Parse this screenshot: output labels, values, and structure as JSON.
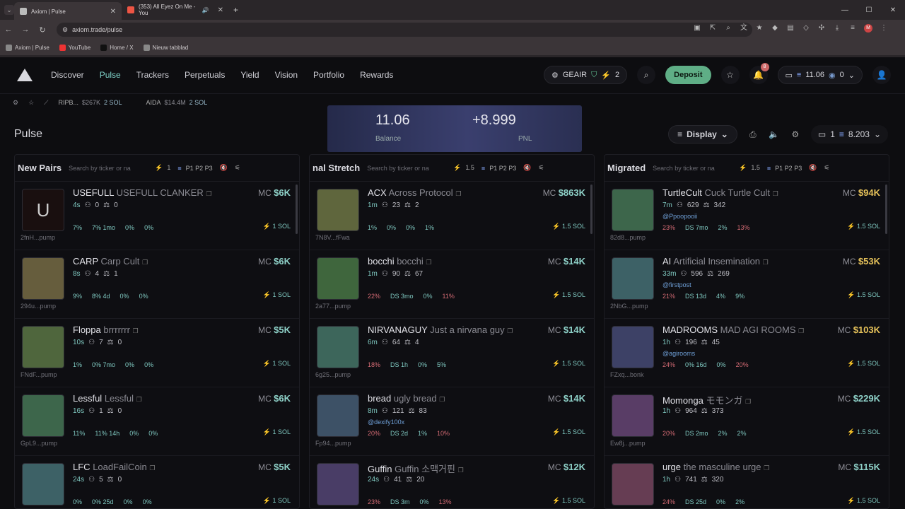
{
  "browser": {
    "tabs": [
      {
        "label": "Axiom | Pulse"
      },
      {
        "label": "(353) All Eyez On Me - You"
      }
    ],
    "url": "axiom.trade/pulse",
    "bookmarks": [
      "Axiom | Pulse",
      "YouTube",
      "Home / X",
      "Nieuw tabblad"
    ],
    "profile": "M"
  },
  "nav": {
    "items": [
      "Discover",
      "Pulse",
      "Trackers",
      "Perpetuals",
      "Yield",
      "Vision",
      "Portfolio",
      "Rewards"
    ],
    "gear_label": "GEAIR",
    "bolt_count": "2",
    "deposit": "Deposit",
    "notif": "8",
    "sol_balance": "11.06",
    "usdc": "0"
  },
  "ticker": [
    {
      "name": "RIPB...",
      "mc": "$267K",
      "sol": "2 SOL"
    },
    {
      "name": "AIDA",
      "mc": "$14.4M",
      "sol": "2 SOL"
    }
  ],
  "page": {
    "title": "Pulse",
    "display": "Display",
    "wallet_count": "1",
    "wallet_sol": "8.203"
  },
  "overlay": {
    "balance": "11.06",
    "balance_label": "Balance",
    "pnl": "+8.999",
    "pnl_label": "PNL"
  },
  "columns": [
    {
      "title": "New Pairs",
      "search": "Search by ticker or na",
      "bolt": "1",
      "presets": "P1 P2 P3",
      "rows": [
        {
          "ticker": "USEFULL",
          "name": "USEFULL CLANKER",
          "age": "4s",
          "holders": "0",
          "pro": "0",
          "mc": "$6K",
          "addr": "2fnH...pump",
          "p": [
            "7%",
            "7% 1mo",
            "0%",
            "0%"
          ],
          "sol": "1 SOL",
          "letter": "U"
        },
        {
          "ticker": "CARP",
          "name": "Carp Cult",
          "age": "8s",
          "holders": "4",
          "pro": "1",
          "mc": "$6K",
          "addr": "294u...pump",
          "p": [
            "9%",
            "8% 4d",
            "0%",
            "0%"
          ],
          "sol": "1 SOL"
        },
        {
          "ticker": "Floppa",
          "name": "brrrrrrr",
          "age": "10s",
          "holders": "7",
          "pro": "0",
          "mc": "$5K",
          "addr": "FNdF...pump",
          "p": [
            "1%",
            "0% 7mo",
            "0%",
            "0%"
          ],
          "sol": "1 SOL"
        },
        {
          "ticker": "Lessful",
          "name": "Lessful",
          "age": "16s",
          "holders": "1",
          "pro": "0",
          "mc": "$6K",
          "addr": "GpL9...pump",
          "p": [
            "11%",
            "11% 14h",
            "0%",
            "0%"
          ],
          "sol": "1 SOL"
        },
        {
          "ticker": "LFC",
          "name": "LoadFailCoin",
          "age": "24s",
          "holders": "5",
          "pro": "0",
          "mc": "$5K",
          "addr": "",
          "p": [
            "0%",
            "0% 25d",
            "0%",
            "0%"
          ],
          "sol": "1 SOL"
        }
      ]
    },
    {
      "title": "nal Stretch",
      "search": "Search by ticker or na",
      "bolt": "1.5",
      "presets": "P1 P2 P3",
      "rows": [
        {
          "ticker": "ACX",
          "name": "Across Protocol",
          "age": "1m",
          "holders": "23",
          "pro": "2",
          "mc": "$863K",
          "addr": "7N8V...fFwa",
          "p": [
            "1%",
            "0%",
            "0%",
            "1%"
          ],
          "sol": "1.5 SOL"
        },
        {
          "ticker": "bocchi",
          "name": "bocchi",
          "age": "1m",
          "holders": "90",
          "pro": "67",
          "mc": "$14K",
          "addr": "2a77...pump",
          "p": [
            "22%",
            "DS 3mo",
            "0%",
            "11%"
          ],
          "sol": "1.5 SOL"
        },
        {
          "ticker": "NIRVANAGUY",
          "name": "Just a nirvana guy",
          "age": "6m",
          "holders": "64",
          "pro": "4",
          "mc": "$14K",
          "addr": "6g25...pump",
          "p": [
            "18%",
            "DS 1h",
            "0%",
            "5%"
          ],
          "sol": "1.5 SOL"
        },
        {
          "ticker": "bread",
          "name": "ugly bread",
          "age": "8m",
          "holders": "121",
          "pro": "83",
          "mc": "$14K",
          "addr": "Fp94...pump",
          "handle": "@dexify100x",
          "p": [
            "20%",
            "DS 2d",
            "1%",
            "10%"
          ],
          "sol": "1.5 SOL"
        },
        {
          "ticker": "Guffin",
          "name": "Guffin 소맥거핀",
          "age": "24s",
          "holders": "41",
          "pro": "20",
          "mc": "$12K",
          "addr": "",
          "p": [
            "23%",
            "DS 3m",
            "0%",
            "13%"
          ],
          "sol": "1.5 SOL"
        }
      ]
    },
    {
      "title": "Migrated",
      "search": "Search by ticker or na",
      "bolt": "1.5",
      "presets": "P1 P2 P3",
      "rows": [
        {
          "ticker": "TurtleCult",
          "name": "Cuck Turtle Cult",
          "age": "7m",
          "holders": "629",
          "pro": "342",
          "mc": "$94K",
          "addr": "82d8...pump",
          "handle": "@Ppoopooii",
          "p": [
            "23%",
            "DS 7mo",
            "2%",
            "13%"
          ],
          "sol": "1.5 SOL"
        },
        {
          "ticker": "AI",
          "name": "Artificial Insemination",
          "age": "33m",
          "holders": "596",
          "pro": "269",
          "mc": "$53K",
          "addr": "2NbG...pump",
          "handle": "@firstpost",
          "p": [
            "21%",
            "DS 13d",
            "4%",
            "9%"
          ],
          "sol": "1.5 SOL"
        },
        {
          "ticker": "MADROOMS",
          "name": "MAD AGI ROOMS",
          "age": "1h",
          "holders": "196",
          "pro": "45",
          "mc": "$103K",
          "addr": "FZxq...bonk",
          "handle": "@agirooms",
          "p": [
            "24%",
            "0% 16d",
            "0%",
            "20%"
          ],
          "sol": "1.5 SOL"
        },
        {
          "ticker": "Momonga",
          "name": "モモンガ",
          "age": "1h",
          "holders": "964",
          "pro": "373",
          "mc": "$229K",
          "addr": "Ew8j...pump",
          "p": [
            "20%",
            "DS 2mo",
            "2%",
            "2%"
          ],
          "sol": "1.5 SOL"
        },
        {
          "ticker": "urge",
          "name": "the masculine urge",
          "age": "1h",
          "holders": "741",
          "pro": "320",
          "mc": "$115K",
          "addr": "",
          "p": [
            "24%",
            "DS 25d",
            "0%",
            "2%"
          ],
          "sol": "1.5 SOL"
        }
      ]
    }
  ]
}
